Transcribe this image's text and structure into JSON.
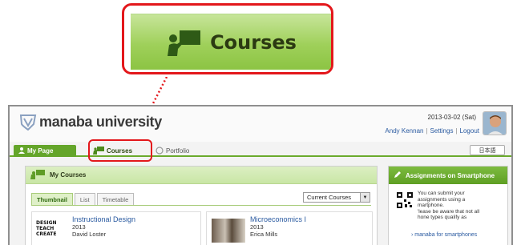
{
  "callout": {
    "label": "Courses",
    "icon": "teacher-board-icon",
    "highlight_color": "#e3171b"
  },
  "header": {
    "logo_text": "manaba university",
    "date": "2013-03-02 (Sat)",
    "user_name": "Andy Kennan",
    "settings": "Settings",
    "logout": "Logout"
  },
  "tabs": {
    "mypage": "My Page",
    "courses": "Courses",
    "portfolio": "Portfolio",
    "language": "日本語"
  },
  "my_courses": {
    "title": "My Courses",
    "subtabs": [
      "Thumbnail",
      "List",
      "Timetable"
    ],
    "active_subtab": "Thumbnail",
    "filter": "Current Courses",
    "courses": [
      {
        "thumb": "DESIGN\nTEACH\nCREATE",
        "title": "Instructional Design",
        "year": "2013",
        "teacher": "David Loster"
      },
      {
        "title": "Microeconomics I",
        "year": "2013",
        "teacher": "Erica Mills"
      }
    ]
  },
  "smartphone": {
    "title": "Assignments on Smartphone",
    "text": "You can submit your\nassignments using a\nmartphone.\n'lease be aware that not all\nhone types qualify as",
    "link": "manaba for smartphones"
  },
  "colors": {
    "accent_green": "#64a52a",
    "link_blue": "#2a5aa0",
    "highlight_red": "#e3171b"
  }
}
